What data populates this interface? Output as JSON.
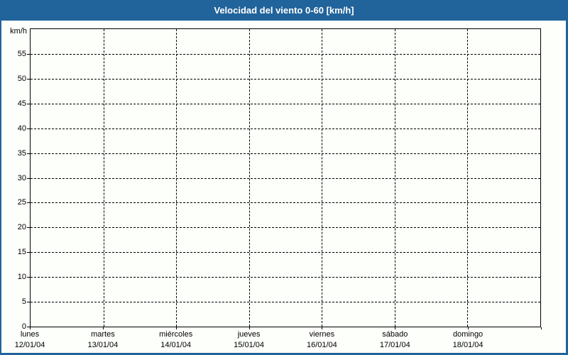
{
  "header": {
    "title": "Velocidad del viento 0-60 [km/h]"
  },
  "colors": {
    "header_bg": "#21639b",
    "frame_border": "#21639b",
    "page_bg": "#fdfffb",
    "title_text": "#ffffff",
    "axis": "#000000",
    "grid": "#000000",
    "label_text": "#000000"
  },
  "chart_data": {
    "type": "line",
    "title": "Velocidad del viento 0-60 [km/h]",
    "ylabel": "km/h",
    "xlabel": "",
    "ylim": [
      0,
      60
    ],
    "yticks": [
      0,
      5,
      10,
      15,
      20,
      25,
      30,
      35,
      40,
      45,
      50,
      55
    ],
    "grid": "dashed",
    "legend": "none",
    "x_segments": 7,
    "x_categories": [
      {
        "day": "lunes",
        "date": "12/01/04"
      },
      {
        "day": "martes",
        "date": "13/01/04"
      },
      {
        "day": "miércoles",
        "date": "14/01/04"
      },
      {
        "day": "jueves",
        "date": "15/01/04"
      },
      {
        "day": "viernes",
        "date": "16/01/04"
      },
      {
        "day": "sábado",
        "date": "17/01/04"
      },
      {
        "day": "domingo",
        "date": "18/01/04"
      }
    ],
    "series": []
  }
}
